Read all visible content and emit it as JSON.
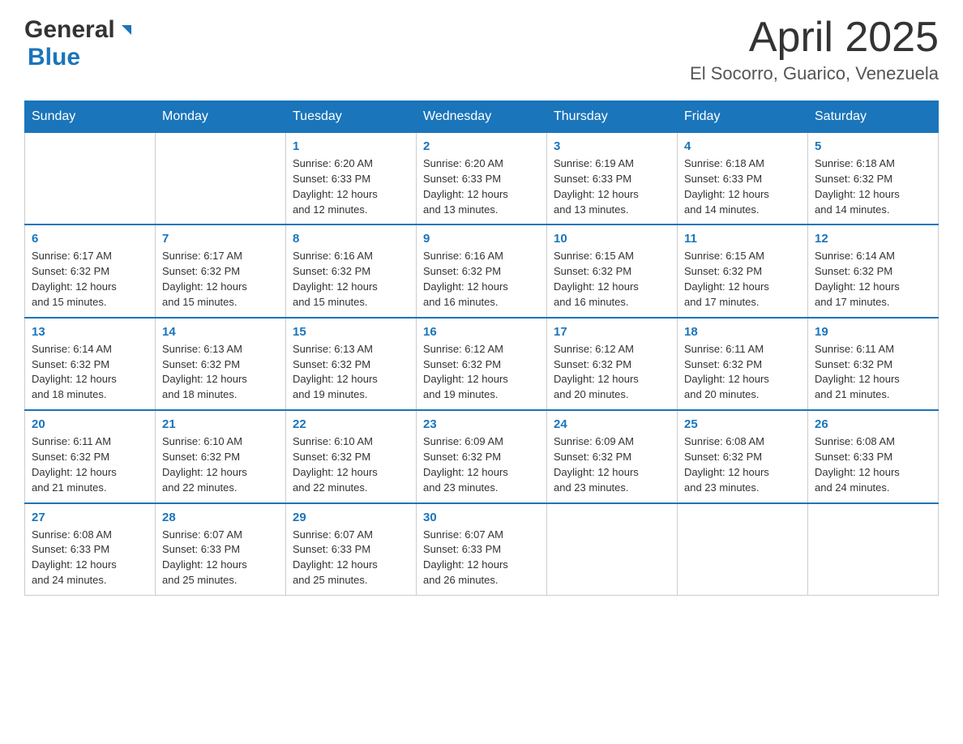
{
  "header": {
    "logo_general": "General",
    "logo_blue": "Blue",
    "month_title": "April 2025",
    "location": "El Socorro, Guarico, Venezuela"
  },
  "days_of_week": [
    "Sunday",
    "Monday",
    "Tuesday",
    "Wednesday",
    "Thursday",
    "Friday",
    "Saturday"
  ],
  "weeks": [
    [
      {
        "day": "",
        "info": ""
      },
      {
        "day": "",
        "info": ""
      },
      {
        "day": "1",
        "info": "Sunrise: 6:20 AM\nSunset: 6:33 PM\nDaylight: 12 hours\nand 12 minutes."
      },
      {
        "day": "2",
        "info": "Sunrise: 6:20 AM\nSunset: 6:33 PM\nDaylight: 12 hours\nand 13 minutes."
      },
      {
        "day": "3",
        "info": "Sunrise: 6:19 AM\nSunset: 6:33 PM\nDaylight: 12 hours\nand 13 minutes."
      },
      {
        "day": "4",
        "info": "Sunrise: 6:18 AM\nSunset: 6:33 PM\nDaylight: 12 hours\nand 14 minutes."
      },
      {
        "day": "5",
        "info": "Sunrise: 6:18 AM\nSunset: 6:32 PM\nDaylight: 12 hours\nand 14 minutes."
      }
    ],
    [
      {
        "day": "6",
        "info": "Sunrise: 6:17 AM\nSunset: 6:32 PM\nDaylight: 12 hours\nand 15 minutes."
      },
      {
        "day": "7",
        "info": "Sunrise: 6:17 AM\nSunset: 6:32 PM\nDaylight: 12 hours\nand 15 minutes."
      },
      {
        "day": "8",
        "info": "Sunrise: 6:16 AM\nSunset: 6:32 PM\nDaylight: 12 hours\nand 15 minutes."
      },
      {
        "day": "9",
        "info": "Sunrise: 6:16 AM\nSunset: 6:32 PM\nDaylight: 12 hours\nand 16 minutes."
      },
      {
        "day": "10",
        "info": "Sunrise: 6:15 AM\nSunset: 6:32 PM\nDaylight: 12 hours\nand 16 minutes."
      },
      {
        "day": "11",
        "info": "Sunrise: 6:15 AM\nSunset: 6:32 PM\nDaylight: 12 hours\nand 17 minutes."
      },
      {
        "day": "12",
        "info": "Sunrise: 6:14 AM\nSunset: 6:32 PM\nDaylight: 12 hours\nand 17 minutes."
      }
    ],
    [
      {
        "day": "13",
        "info": "Sunrise: 6:14 AM\nSunset: 6:32 PM\nDaylight: 12 hours\nand 18 minutes."
      },
      {
        "day": "14",
        "info": "Sunrise: 6:13 AM\nSunset: 6:32 PM\nDaylight: 12 hours\nand 18 minutes."
      },
      {
        "day": "15",
        "info": "Sunrise: 6:13 AM\nSunset: 6:32 PM\nDaylight: 12 hours\nand 19 minutes."
      },
      {
        "day": "16",
        "info": "Sunrise: 6:12 AM\nSunset: 6:32 PM\nDaylight: 12 hours\nand 19 minutes."
      },
      {
        "day": "17",
        "info": "Sunrise: 6:12 AM\nSunset: 6:32 PM\nDaylight: 12 hours\nand 20 minutes."
      },
      {
        "day": "18",
        "info": "Sunrise: 6:11 AM\nSunset: 6:32 PM\nDaylight: 12 hours\nand 20 minutes."
      },
      {
        "day": "19",
        "info": "Sunrise: 6:11 AM\nSunset: 6:32 PM\nDaylight: 12 hours\nand 21 minutes."
      }
    ],
    [
      {
        "day": "20",
        "info": "Sunrise: 6:11 AM\nSunset: 6:32 PM\nDaylight: 12 hours\nand 21 minutes."
      },
      {
        "day": "21",
        "info": "Sunrise: 6:10 AM\nSunset: 6:32 PM\nDaylight: 12 hours\nand 22 minutes."
      },
      {
        "day": "22",
        "info": "Sunrise: 6:10 AM\nSunset: 6:32 PM\nDaylight: 12 hours\nand 22 minutes."
      },
      {
        "day": "23",
        "info": "Sunrise: 6:09 AM\nSunset: 6:32 PM\nDaylight: 12 hours\nand 23 minutes."
      },
      {
        "day": "24",
        "info": "Sunrise: 6:09 AM\nSunset: 6:32 PM\nDaylight: 12 hours\nand 23 minutes."
      },
      {
        "day": "25",
        "info": "Sunrise: 6:08 AM\nSunset: 6:32 PM\nDaylight: 12 hours\nand 23 minutes."
      },
      {
        "day": "26",
        "info": "Sunrise: 6:08 AM\nSunset: 6:33 PM\nDaylight: 12 hours\nand 24 minutes."
      }
    ],
    [
      {
        "day": "27",
        "info": "Sunrise: 6:08 AM\nSunset: 6:33 PM\nDaylight: 12 hours\nand 24 minutes."
      },
      {
        "day": "28",
        "info": "Sunrise: 6:07 AM\nSunset: 6:33 PM\nDaylight: 12 hours\nand 25 minutes."
      },
      {
        "day": "29",
        "info": "Sunrise: 6:07 AM\nSunset: 6:33 PM\nDaylight: 12 hours\nand 25 minutes."
      },
      {
        "day": "30",
        "info": "Sunrise: 6:07 AM\nSunset: 6:33 PM\nDaylight: 12 hours\nand 26 minutes."
      },
      {
        "day": "",
        "info": ""
      },
      {
        "day": "",
        "info": ""
      },
      {
        "day": "",
        "info": ""
      }
    ]
  ]
}
